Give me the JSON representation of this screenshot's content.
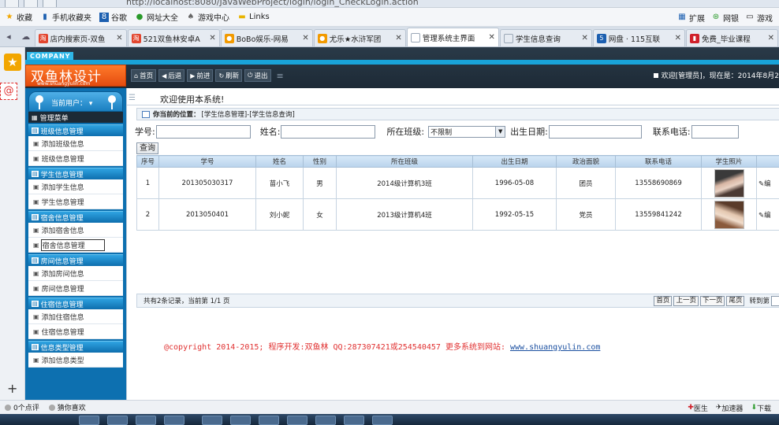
{
  "browser": {
    "address_text": "http://localhost:8080/JavaWebProject/login/login_CheckLogin.action",
    "bookmarks": [
      {
        "label": "收藏",
        "icon": "star-icon"
      },
      {
        "label": "手机收藏夹",
        "icon": "phone-icon"
      },
      {
        "label": "谷歌",
        "icon": "google-icon"
      },
      {
        "label": "网址大全",
        "icon": "globe-icon"
      },
      {
        "label": "游戏中心",
        "icon": "gamepad-icon"
      },
      {
        "label": "Links",
        "icon": "folder-icon"
      }
    ],
    "bookmarks_right": [
      {
        "label": "扩展",
        "icon": "grid-icon"
      },
      {
        "label": "网银",
        "icon": "bank-icon"
      },
      {
        "label": "游戏",
        "icon": "game-icon"
      }
    ],
    "tabs": [
      {
        "label": "店内搜索页-双鱼",
        "color": "#e2462f"
      },
      {
        "label": "521双鱼林安卓A",
        "color": "#e2462f"
      },
      {
        "label": "BoBo娱乐-网易",
        "color": "#f29a00"
      },
      {
        "label": "尤乐★水浒军团",
        "color": "#f29a00"
      },
      {
        "label": "管理系统主界面",
        "color": "#9aa7b6",
        "active": true
      },
      {
        "label": "学生信息查询",
        "color": "#9aa7b6"
      },
      {
        "label": "网盘 · 115互联",
        "color": "#1c5fb0"
      },
      {
        "label": "免费_毕业课程",
        "color": "#d0202a"
      }
    ]
  },
  "app": {
    "company_tag": "COMPANY",
    "logo_text": "双鱼林设计",
    "logo_url": "www.shuangyulin.com",
    "toolbar": {
      "home": "首页",
      "back": "后退",
      "forward": "前进",
      "refresh": "刷新",
      "logout": "退出"
    },
    "welcome": "欢迎[管理员]，现在是：2014年8月2"
  },
  "sidebar": {
    "current_user_label": "当前用户：",
    "menu_title": "管理菜单",
    "sections": [
      {
        "title": "班级信息管理",
        "items": [
          "添加班级信息",
          "班级信息管理"
        ]
      },
      {
        "title": "学生信息管理",
        "items": [
          "添加学生信息",
          "学生信息管理"
        ]
      },
      {
        "title": "宿舍信息管理",
        "items": [
          "添加宿舍信息",
          "宿舍信息管理"
        ]
      },
      {
        "title": "房间信息管理",
        "items": [
          "添加房间信息",
          "房间信息管理"
        ]
      },
      {
        "title": "住宿信息管理",
        "items": [
          "添加住宿信息",
          "住宿信息管理"
        ]
      },
      {
        "title": "信息类型管理",
        "items": [
          "添加信息类型"
        ]
      }
    ]
  },
  "main": {
    "title": "欢迎使用本系统!",
    "location_label": "你当前的位置：",
    "location_path": "[学生信息管理]-[学生信息查询]",
    "search": {
      "student_no_label": "学号:",
      "name_label": "姓名:",
      "class_label": "所在班级:",
      "class_value": "不限制",
      "birth_label": "出生日期:",
      "phone_label": "联系电话:",
      "query_button": "查询"
    },
    "table": {
      "headers": [
        "序号",
        "学号",
        "姓名",
        "性别",
        "所在班级",
        "出生日期",
        "政治面貌",
        "联系电话",
        "学生照片",
        ""
      ],
      "rows": [
        {
          "seq": "1",
          "no": "201305030317",
          "name": "苗小飞",
          "gender": "男",
          "class": "2014级计算机3班",
          "birth": "1996-05-08",
          "politics": "团员",
          "phone": "13558690869",
          "edit": "编"
        },
        {
          "seq": "2",
          "no": "2013050401",
          "name": "刘小妮",
          "gender": "女",
          "class": "2013级计算机4班",
          "birth": "1992-05-15",
          "politics": "党员",
          "phone": "13559841242",
          "edit": "编"
        }
      ]
    },
    "footer": {
      "summary": "共有2条记录，当前第 1/1 页",
      "first": "首页",
      "prev": "上一页",
      "next": "下一页",
      "last": "尾页",
      "goto": "转到第"
    }
  },
  "copyright": {
    "text": "@copyright 2014-2015; 程序开发:双鱼林  QQ:287307421或254540457  更多系统到网站: ",
    "link": "www.shuangyulin.com"
  },
  "statusbar": {
    "left": [
      "0个点评",
      "猜你喜欢"
    ],
    "right": [
      "医生",
      "加速器",
      "下载"
    ]
  }
}
